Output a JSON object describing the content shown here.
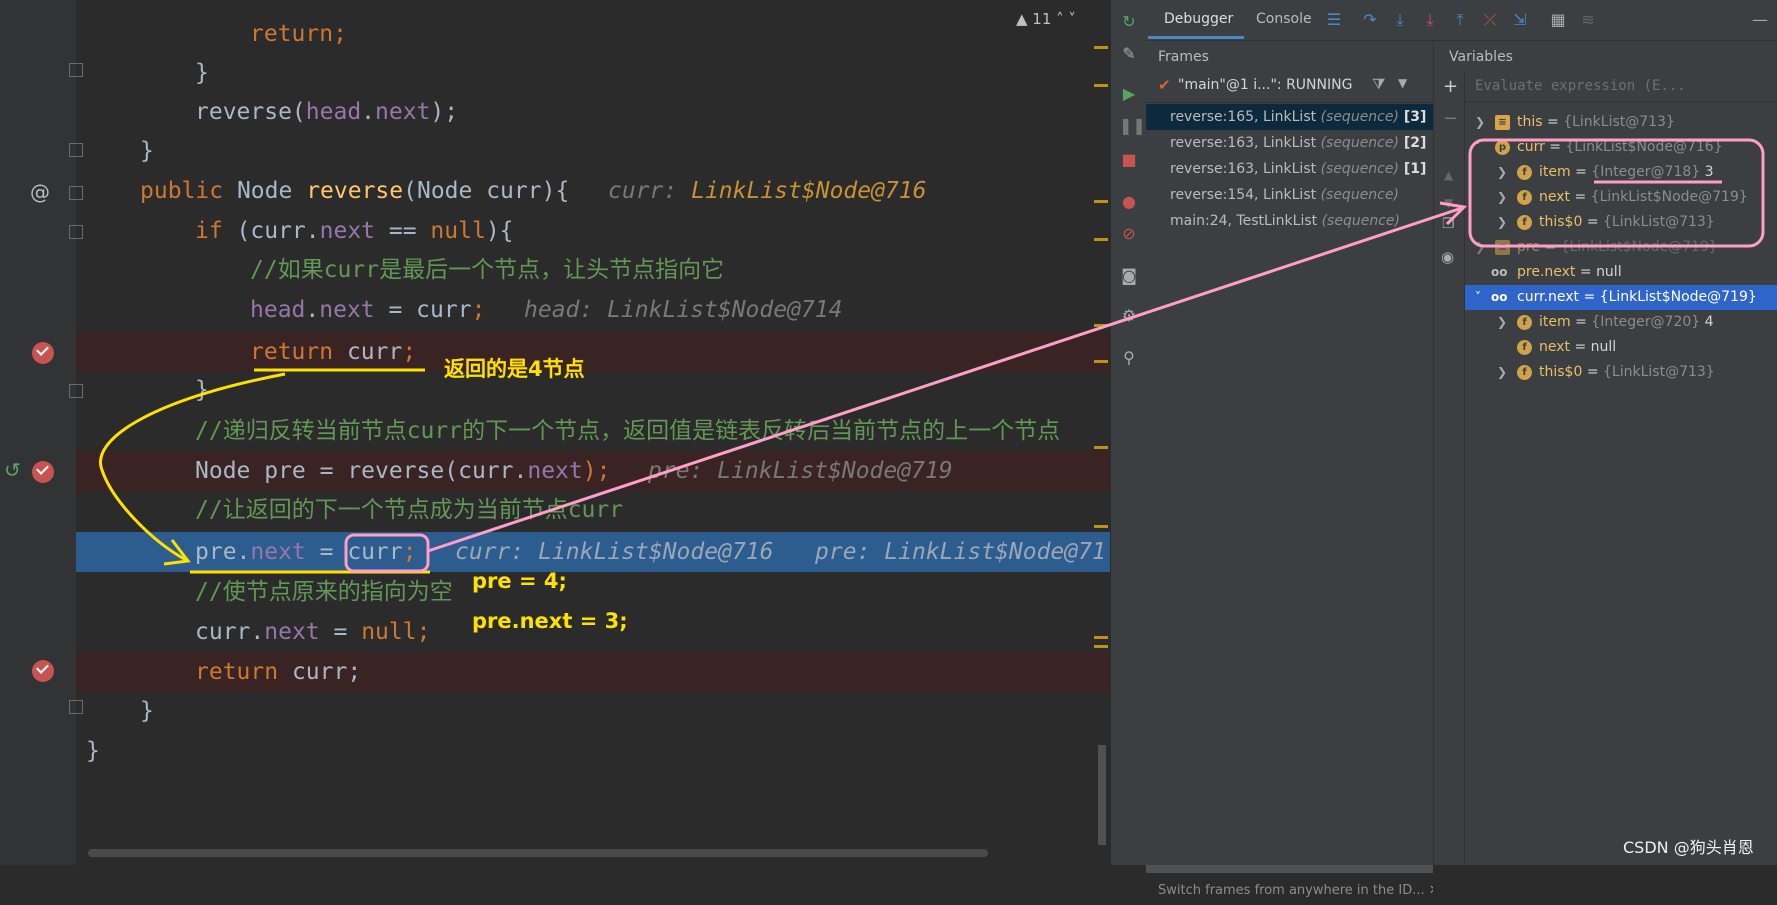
{
  "editor": {
    "warning_count": "▲ 11",
    "lines": {
      "l0": {
        "ret": "return;"
      },
      "l1": {
        "brace": "}"
      },
      "l2": {
        "a": "reverse(",
        "b": "head",
        "c": ".",
        "d": "next",
        "e": ");"
      },
      "l3": {
        "brace": "}"
      },
      "l4": {
        "a": "public ",
        "b": "Node ",
        "c": "reverse",
        "d": "(Node curr){",
        "hint_a": "curr: ",
        "hint_b": "LinkList$Node@716"
      },
      "l5": {
        "a": "if ",
        "b": "(curr.",
        "c": "next",
        "d": " == ",
        "e": "null",
        "f": "){"
      },
      "l6": {
        "comment": "//如果curr是最后一个节点，让头节点指向它"
      },
      "l7": {
        "a": "head",
        "b": ".",
        "c": "next",
        "d": " = curr",
        "e": ";",
        "hint": "head: LinkList$Node@714"
      },
      "l8": {
        "a": "return ",
        "b": "curr",
        "c": ";"
      },
      "l9": {
        "brace": "}"
      },
      "l10": {
        "comment": "//递归反转当前节点curr的下一个节点，返回值是链表反转后当前节点的上一个节点"
      },
      "l11": {
        "a": "Node pre = reverse(curr.",
        "b": "next",
        "c": ");",
        "hint": "pre: LinkList$Node@719"
      },
      "l12": {
        "comment": "//让返回的下一个节点成为当前节点curr"
      },
      "l13": {
        "a": "pre.",
        "b": "next",
        "c": " = ",
        "d": "curr",
        "e": ";",
        "hint": "curr: LinkList$Node@716   pre: LinkList$Node@71"
      },
      "l14": {
        "comment": "//使节点原来的指向为空"
      },
      "l15": {
        "a": "curr.",
        "b": "next",
        "c": " = ",
        "d": "null",
        "e": ";"
      },
      "l16": {
        "a": "return ",
        "b": "curr;"
      },
      "l17": {
        "brace": "}"
      },
      "l18": {
        "brace": "}"
      }
    },
    "notes": {
      "returned": "返回的是4节点",
      "pre_val": "pre = 4;",
      "pre_next_val": "pre.next = 3;"
    }
  },
  "debugger": {
    "tabs": [
      "Debugger",
      "Console"
    ],
    "frames_title": "Frames",
    "variables_title": "Variables",
    "thread": "\"main\"@1 i...\": RUNNING",
    "frames": [
      {
        "loc": "reverse:165, LinkList ",
        "cls": "(sequence)",
        "depth": " [3]"
      },
      {
        "loc": "reverse:163, LinkList ",
        "cls": "(sequence)",
        "depth": " [2]"
      },
      {
        "loc": "reverse:163, LinkList ",
        "cls": "(sequence)",
        "depth": " [1]"
      },
      {
        "loc": "reverse:154, LinkList ",
        "cls": "(sequence)",
        "depth": ""
      },
      {
        "loc": "main:24, TestLinkList ",
        "cls": "(sequence)",
        "depth": ""
      }
    ],
    "eval_placeholder": "Evaluate expression (E...",
    "variables": [
      {
        "name": "this",
        "eq": " = ",
        "type": "{LinkList@713}",
        "val": ""
      },
      {
        "name": "curr",
        "eq": " = ",
        "type": "{LinkList$Node@716}",
        "val": ""
      },
      {
        "name": "item",
        "eq": " = ",
        "type": "{Integer@718}",
        "val": " 3"
      },
      {
        "name": "next",
        "eq": " = ",
        "type": "{LinkList$Node@719}",
        "val": ""
      },
      {
        "name": "this$0",
        "eq": " = ",
        "type": "{LinkList@713}",
        "val": ""
      },
      {
        "name": "pre",
        "eq": " = ",
        "type": "{LinkList$Node@719}",
        "val": ""
      },
      {
        "name": "pre.next",
        "eq": " = ",
        "type": "",
        "val": "null"
      },
      {
        "name": "curr.next",
        "eq": " = ",
        "type": "{LinkList$Node@719}",
        "val": ""
      },
      {
        "name": "item",
        "eq": " = ",
        "type": "{Integer@720}",
        "val": " 4"
      },
      {
        "name": "next",
        "eq": " = ",
        "type": "",
        "val": "null"
      },
      {
        "name": "this$0",
        "eq": " = ",
        "type": "{LinkList@713}",
        "val": ""
      }
    ],
    "status": "Switch frames from anywhere in the ID...",
    "watermark": "CSDN @狗头肖恩"
  },
  "colors": {
    "breakpoint": "#c75450",
    "current_line": "#2d5c8e",
    "annotation_yellow": "#ffe100",
    "annotation_pink": "#ff9ec8"
  }
}
